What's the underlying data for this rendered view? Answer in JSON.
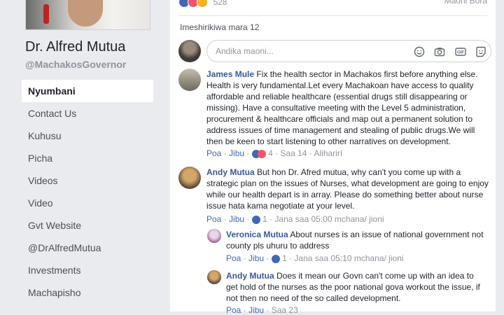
{
  "sidebar": {
    "name": "Dr. Alfred Mutua",
    "handle": "@MachakosGovernor",
    "items": [
      {
        "label": "Nyumbani",
        "active": true
      },
      {
        "label": "Contact Us"
      },
      {
        "label": "Kuhusu"
      },
      {
        "label": "Picha"
      },
      {
        "label": "Videos"
      },
      {
        "label": "Video"
      },
      {
        "label": "Gvt Website"
      },
      {
        "label": "@DrAlfredMutua"
      },
      {
        "label": "Investments"
      },
      {
        "label": "Machapisho"
      }
    ]
  },
  "post": {
    "reaction_count": "528",
    "sort_label": "Maoni Bora",
    "views": "Imeshirikiwa mara 12",
    "composer_placeholder": "Andika maoni..."
  },
  "comments": [
    {
      "author": "James Mule",
      "text": "Fix the health sector in Machakos first before anything else. Health is very fundamental.Let every Machakoan have access to quality affordable and reliable healthcare (essential drugs still disappearing or missing). Have a consultative meeting with the Level 5 administration, procurement & healthcare officials and map out a permanent solution to address issues of time management and stealing of public drugs.We will then be keen to start listening to other narratives on development.",
      "like": "Poa",
      "reply": "Jibu",
      "reactions": "4",
      "time": "Saa 14",
      "edited": "Aliharirí"
    },
    {
      "author": "Andy Mutua",
      "text": "But hon Dr. Afred mutua, why can't you come up with a strategic plan on the issues of Nurses, what development are going to enjoy while our health depart is in array. Please do something better about nurse issue hata kama negotiate at your level.",
      "like": "Poa",
      "reply": "Jibu",
      "reactions": "1",
      "time": "Jana saa 05:00 mchana/ jioni"
    }
  ],
  "replies": [
    {
      "author": "Veronica Mutua",
      "text": "About nurses is an issue of national government not county pls uhuru to address",
      "like": "Poa",
      "reply": "Jibu",
      "reactions": "1",
      "time": "Jana saa 05:10 mchana/ jioni"
    },
    {
      "author": "Andy Mutua",
      "text": "Does it mean our Govn can't come up with an idea to get hold of the nurses as the poor national gova workout the issue, if not then no need of the so called development.",
      "like": "Poa",
      "reply": "Jibu",
      "time": "Saa 23"
    }
  ],
  "icons": [
    "like-reaction-icon",
    "love-reaction-icon",
    "wow-reaction-icon",
    "emoji-icon",
    "camera-icon",
    "gif-icon",
    "sticker-icon"
  ]
}
